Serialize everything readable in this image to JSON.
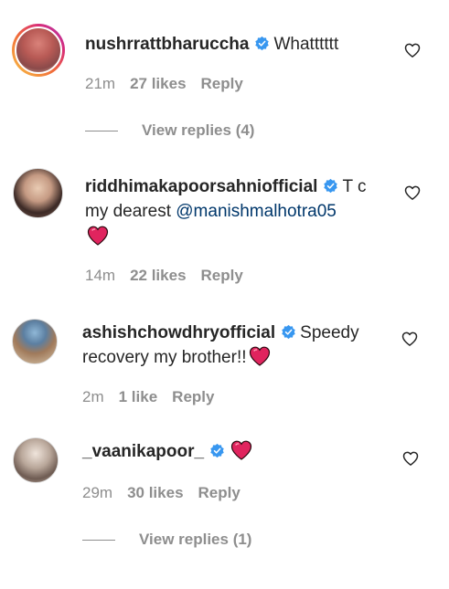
{
  "comments": [
    {
      "username": "nushrrattbharuccha",
      "verified": true,
      "text": "Whatttttt",
      "time": "21m",
      "likes": "27 likes",
      "reply": "Reply",
      "view_replies": "View replies (4)"
    },
    {
      "username": "riddhimakapoorsahniofficial",
      "verified": true,
      "text_line1": "T c",
      "text_line2_prefix": "my dearest ",
      "mention": "@manishmalhotra05",
      "time": "14m",
      "likes": "22 likes",
      "reply": "Reply"
    },
    {
      "username": "ashishchowdhryofficial",
      "verified": true,
      "text_line1": "Speedy",
      "text_line2": "recovery my brother!!",
      "time": "2m",
      "likes": "1 like",
      "reply": "Reply"
    },
    {
      "username": "_vaanikapoor_",
      "verified": true,
      "text": "",
      "time": "29m",
      "likes": "30 likes",
      "reply": "Reply",
      "view_replies": "View replies (1)"
    }
  ],
  "colors": {
    "text": "#262626",
    "meta": "#8e8e8e",
    "mention": "#00376b",
    "verified": "#3897f0",
    "heart_emoji": "#e0245e"
  },
  "icons": {
    "like": "heart-outline-icon",
    "verified": "verified-badge-icon",
    "emoji": "red-heart-emoji"
  }
}
